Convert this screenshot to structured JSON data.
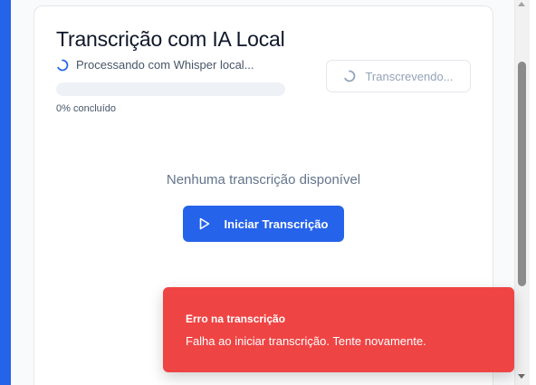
{
  "colors": {
    "primary": "#2563eb",
    "error": "#ef4444",
    "card": "#ffffff",
    "muted_text": "#64748b",
    "disabled_text": "#94a3b8"
  },
  "header": {
    "title": "Transcrição com IA Local",
    "status_icon": "spinner-icon",
    "status_text": "Processando com Whisper local..."
  },
  "progress": {
    "value": 0,
    "label": "0% concluído"
  },
  "transcribing_button": {
    "icon": "spinner-icon",
    "label": "Transcrevendo..."
  },
  "empty_state": {
    "message": "Nenhuma transcrição disponível"
  },
  "start_button": {
    "icon": "play-icon",
    "label": "Iniciar Transcrição"
  },
  "toast": {
    "title": "Erro na transcrição",
    "message": "Falha ao iniciar transcrição. Tente novamente."
  }
}
